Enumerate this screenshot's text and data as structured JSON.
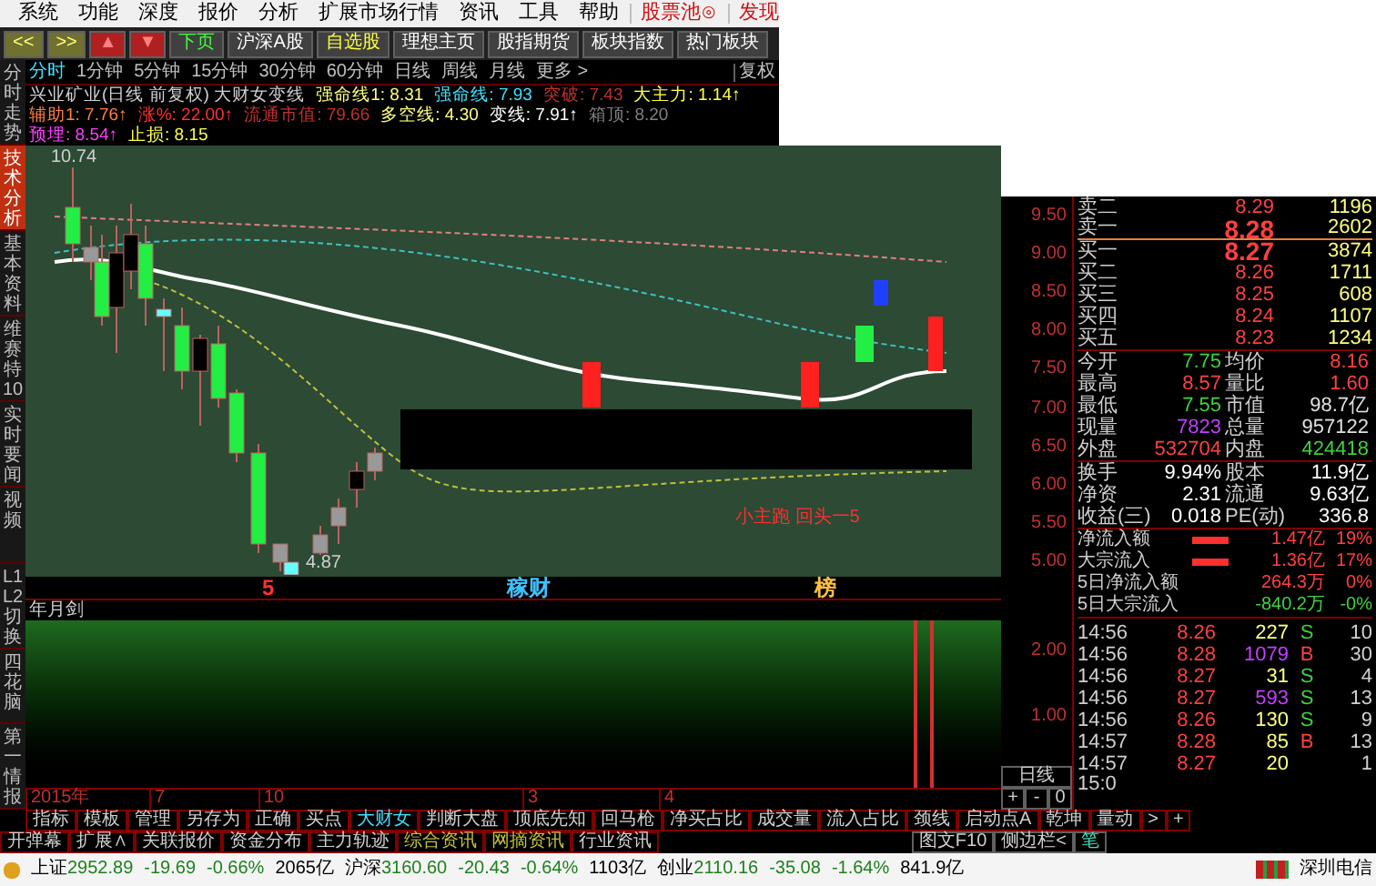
{
  "menu": {
    "items": [
      {
        "label": "系统",
        "kind": "plain"
      },
      {
        "label": "功能",
        "kind": "plain"
      },
      {
        "label": "深度",
        "kind": "plain"
      },
      {
        "label": "报价",
        "kind": "plain"
      },
      {
        "label": "分析",
        "kind": "plain"
      },
      {
        "label": "扩展市场行情",
        "kind": "plain"
      },
      {
        "label": "资讯",
        "kind": "plain"
      },
      {
        "label": "工具",
        "kind": "plain"
      },
      {
        "label": "帮助",
        "kind": "plain"
      },
      {
        "label": "股票池⊙",
        "kind": "accent"
      },
      {
        "label": "发现",
        "kind": "accent"
      }
    ]
  },
  "toolbar": [
    {
      "label": "<<",
      "kind": "nav"
    },
    {
      "label": ">>",
      "kind": "nav"
    },
    {
      "label": "▲",
      "kind": "arrow"
    },
    {
      "label": "▼",
      "kind": "arrow"
    },
    {
      "label": "下页",
      "kind": "green"
    },
    {
      "label": "沪深A股",
      "kind": "plain"
    },
    {
      "label": "自选股",
      "kind": "yellow"
    },
    {
      "label": "理想主页",
      "kind": "plain"
    },
    {
      "label": "股指期货",
      "kind": "plain"
    },
    {
      "label": "板块指数",
      "kind": "plain"
    },
    {
      "label": "热门板块",
      "kind": "plain"
    }
  ],
  "side_tabs": [
    {
      "label": "分时走势",
      "selected": false
    },
    {
      "label": "技术分析",
      "selected": true
    },
    {
      "label": "基本资料",
      "selected": false
    },
    {
      "label": "维赛特10",
      "selected": false
    },
    {
      "label": "实时要闻",
      "selected": false
    },
    {
      "label": "视频",
      "selected": false
    },
    {
      "label": "L1L2切换",
      "selected": false
    },
    {
      "label": "四花脑",
      "selected": false
    },
    {
      "label": "第一情报",
      "selected": false
    }
  ],
  "periods": {
    "items": [
      {
        "label": "分时",
        "selected": true
      },
      {
        "label": "1分钟",
        "selected": false
      },
      {
        "label": "5分钟",
        "selected": false
      },
      {
        "label": "15分钟",
        "selected": false
      },
      {
        "label": "30分钟",
        "selected": false
      },
      {
        "label": "60分钟",
        "selected": false
      },
      {
        "label": "日线",
        "selected": false
      },
      {
        "label": "周线",
        "selected": false
      },
      {
        "label": "月线",
        "selected": false
      },
      {
        "label": "更多 >",
        "selected": false
      }
    ],
    "adjust": "复权"
  },
  "indicator_header": [
    [
      {
        "text": "兴业矿业(日线 前复权) 大财女变线",
        "color": "#d0d0d0"
      },
      {
        "text": "强命线1: 8.31",
        "color": "#ffff80"
      },
      {
        "text": "强命线: 7.93",
        "color": "#40e0ff"
      },
      {
        "text": "突破: 7.43",
        "color": "#c03030"
      },
      {
        "text": "大主力: 1.14↑",
        "color": "#ffff40"
      }
    ],
    [
      {
        "text": "辅助1: 7.76↑",
        "color": "#ff8040"
      },
      {
        "text": "涨%: 22.00↑",
        "color": "#ff3030"
      },
      {
        "text": "流通市值: 79.66",
        "color": "#c03030"
      },
      {
        "text": "多空线: 4.30",
        "color": "#ffff80"
      },
      {
        "text": "变线: 7.91↑",
        "color": "#ffffff"
      },
      {
        "text": "箱顶: 8.20",
        "color": "#808080"
      }
    ],
    [
      {
        "text": "预埋: 8.54↑",
        "color": "#ff40ff"
      },
      {
        "text": "止损: 8.15",
        "color": "#ffff40"
      }
    ]
  ],
  "chart": {
    "high_label": "10.74",
    "low_label": "4.87",
    "annotation": "小主跑  回头一5",
    "markers": [
      {
        "text": "5",
        "kind": "count"
      },
      {
        "text": "稼财",
        "kind": "signal"
      },
      {
        "text": "榜",
        "kind": "rank"
      }
    ]
  },
  "price_axis": [
    "9.50",
    "9.00",
    "8.50",
    "8.00",
    "7.50",
    "7.00",
    "6.50",
    "6.00",
    "5.50",
    "5.00"
  ],
  "sub_chart": {
    "title": "年月剑",
    "axis": [
      "2.00",
      "1.00"
    ]
  },
  "date_axis": [
    "2015年",
    "7",
    "10",
    "3",
    "4"
  ],
  "period_button": "日线",
  "zoom_buttons": [
    "+",
    "-",
    "0"
  ],
  "quote": {
    "book": [
      {
        "label": "卖二",
        "price": "8.29",
        "volume": "1196",
        "large": false
      },
      {
        "label": "卖一",
        "price": "8.28",
        "volume": "2602",
        "large": true
      },
      {
        "label": "买一",
        "price": "8.27",
        "volume": "3874",
        "large": true
      },
      {
        "label": "买二",
        "price": "8.26",
        "volume": "1711",
        "large": false
      },
      {
        "label": "买三",
        "price": "8.25",
        "volume": "608",
        "large": false
      },
      {
        "label": "买四",
        "price": "8.24",
        "volume": "1107",
        "large": false
      },
      {
        "label": "买五",
        "price": "8.23",
        "volume": "1234",
        "large": false
      }
    ],
    "stats": [
      [
        {
          "label": "今开",
          "value": "7.75",
          "color": "#40d040"
        },
        {
          "label": "均价",
          "value": "8.16",
          "color": "#ff4040"
        }
      ],
      [
        {
          "label": "最高",
          "value": "8.57",
          "color": "#ff4040"
        },
        {
          "label": "量比",
          "value": "1.60",
          "color": "#ff4040"
        }
      ],
      [
        {
          "label": "最低",
          "value": "7.55",
          "color": "#40d040"
        },
        {
          "label": "市值",
          "value": "98.7亿",
          "color": "#e0e0e0"
        }
      ],
      [
        {
          "label": "现量",
          "value": "7823",
          "color": "#c040ff"
        },
        {
          "label": "总量",
          "value": "957122",
          "color": "#e0e0e0"
        }
      ],
      [
        {
          "label": "外盘",
          "value": "532704",
          "color": "#ff4040"
        },
        {
          "label": "内盘",
          "value": "424418",
          "color": "#40d040"
        }
      ]
    ],
    "stats2": [
      [
        {
          "label": "换手",
          "value": "9.94%"
        },
        {
          "label": "股本",
          "value": "11.9亿"
        }
      ],
      [
        {
          "label": "净资",
          "value": "2.31"
        },
        {
          "label": "流通",
          "value": "9.63亿"
        }
      ],
      [
        {
          "label": "收益(三)",
          "value": "0.018"
        },
        {
          "label": "PE(动)",
          "value": "336.8"
        }
      ]
    ],
    "flows": [
      {
        "label": "净流入额",
        "bar": true,
        "amount": "1.47亿",
        "pct": "19%",
        "color": "#ff4040"
      },
      {
        "label": "大宗流入",
        "bar": true,
        "amount": "1.36亿",
        "pct": "17%",
        "color": "#ff4040"
      },
      {
        "label": "5日净流入额",
        "bar": false,
        "amount": "264.3万",
        "pct": "0%",
        "color": "#ff4040"
      },
      {
        "label": "5日大宗流入",
        "bar": false,
        "amount": "-840.2万",
        "pct": "-0%",
        "color": "#40d040"
      }
    ],
    "ticks": [
      {
        "time": "14:56",
        "price": "8.26",
        "volume": "227",
        "side": "S",
        "count": "10",
        "big": false
      },
      {
        "time": "14:56",
        "price": "8.28",
        "volume": "1079",
        "side": "B",
        "count": "30",
        "big": true
      },
      {
        "time": "14:56",
        "price": "8.27",
        "volume": "31",
        "side": "S",
        "count": "4",
        "big": false
      },
      {
        "time": "14:56",
        "price": "8.27",
        "volume": "593",
        "side": "S",
        "count": "13",
        "big": true
      },
      {
        "time": "14:56",
        "price": "8.26",
        "volume": "130",
        "side": "S",
        "count": "9",
        "big": false
      },
      {
        "time": "14:57",
        "price": "8.28",
        "volume": "85",
        "side": "B",
        "count": "13",
        "big": false
      },
      {
        "time": "14:57",
        "price": "8.27",
        "volume": "20",
        "count": "1",
        "big": false
      }
    ],
    "tick_partial": "15:0"
  },
  "bottom_tabs": [
    {
      "label": "指标",
      "selected": false
    },
    {
      "label": "模板",
      "selected": false
    },
    {
      "label": "管理",
      "selected": false
    },
    {
      "label": "另存为",
      "selected": false
    },
    {
      "label": "正确",
      "selected": false
    },
    {
      "label": "买点",
      "selected": false
    },
    {
      "label": "大财女",
      "selected": true
    },
    {
      "label": "判断大盘",
      "selected": false
    },
    {
      "label": "顶底先知",
      "selected": false
    },
    {
      "label": "回马枪",
      "selected": false
    },
    {
      "label": "净买占比",
      "selected": false
    },
    {
      "label": "成交量",
      "selected": false
    },
    {
      "label": "流入占比",
      "selected": false
    },
    {
      "label": "颈线",
      "selected": false
    },
    {
      "label": "启动点A",
      "selected": false
    },
    {
      "label": "乾坤",
      "selected": false
    },
    {
      "label": "量动",
      "selected": false
    },
    {
      "label": ">",
      "selected": false
    },
    {
      "label": "+",
      "selected": false
    }
  ],
  "info_tabs": [
    {
      "label": "开弹幕",
      "kind": "plain"
    },
    {
      "label": "扩展∧",
      "kind": "plain"
    },
    {
      "label": "关联报价",
      "kind": "plain"
    },
    {
      "label": "资金分布",
      "kind": "plain"
    },
    {
      "label": "主力轨迹",
      "kind": "plain"
    },
    {
      "label": "综合资讯",
      "kind": "accent"
    },
    {
      "label": "网摘资讯",
      "kind": "accent"
    },
    {
      "label": "行业资讯",
      "kind": "plain"
    }
  ],
  "right_tabs": [
    "图文F10",
    "侧边栏<",
    "笔"
  ],
  "status_bar": {
    "indices": [
      {
        "name": "上证",
        "value": "2952.89",
        "change": "-19.69",
        "pct": "-0.66%",
        "amount": "2065亿"
      },
      {
        "name": "沪深",
        "value": "3160.60",
        "change": "-20.43",
        "pct": "-0.64%",
        "amount": "1103亿"
      },
      {
        "name": "创业",
        "value": "2110.16",
        "change": "-35.08",
        "pct": "-1.64%",
        "amount": "841.9亿"
      }
    ],
    "server": "深圳电信"
  }
}
